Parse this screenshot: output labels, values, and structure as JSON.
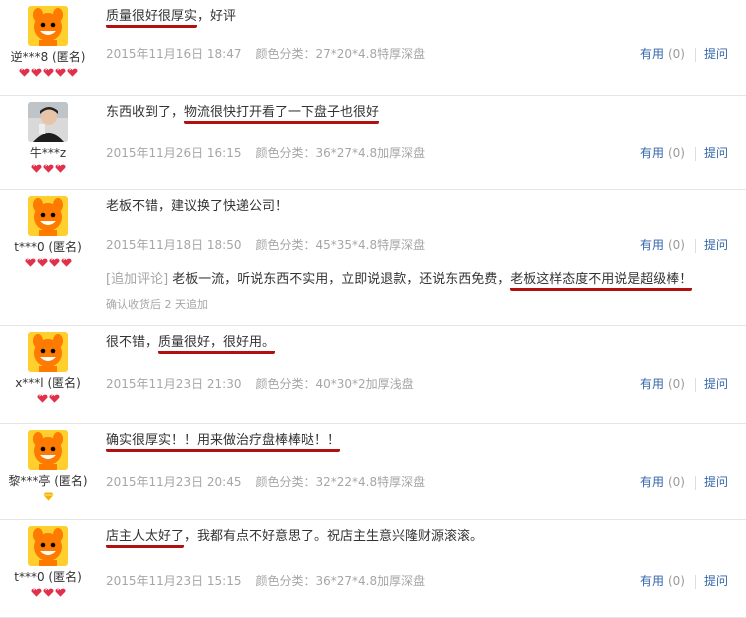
{
  "reviews": [
    {
      "user": "逆***8 (匿名)",
      "avatar": "taobao-mascot",
      "badge": "red-heart",
      "badge_count": 5,
      "text_parts": [
        {
          "t": "质量很好很厚实",
          "u": true
        },
        {
          "t": "，好评",
          "u": false
        }
      ],
      "date": "2015年11月16日 18:47",
      "sku": "颜色分类：27*20*4.8特厚深盘",
      "useful_label": "有用",
      "useful_count": "(0)",
      "ask_label": "提问"
    },
    {
      "user": "牛***z",
      "avatar": "user-photo",
      "badge": "red-heart",
      "badge_count": 3,
      "text_parts": [
        {
          "t": "东西收到了，",
          "u": false
        },
        {
          "t": "物流很快打开看了一下盘子也很好",
          "u": true
        }
      ],
      "date": "2015年11月26日 16:15",
      "sku": "颜色分类：36*27*4.8加厚深盘",
      "useful_label": "有用",
      "useful_count": "(0)",
      "ask_label": "提问"
    },
    {
      "user": "t***0 (匿名)",
      "avatar": "taobao-mascot",
      "badge": "red-heart",
      "badge_count": 4,
      "text_parts": [
        {
          "t": "老板不错，建议换了快递公司！",
          "u": false
        }
      ],
      "date": "2015年11月18日 18:50",
      "sku": "颜色分类：45*35*4.8特厚深盘",
      "useful_label": "有用",
      "useful_count": "(0)",
      "ask_label": "提问",
      "append": {
        "tag": "[追加评论]",
        "parts": [
          {
            "t": " 老板一流，听说东西不实用，立即说退款，还说东西免费，",
            "u": false
          },
          {
            "t": "老板这样态度不用说是超级棒！",
            "u": true
          }
        ],
        "meta": "确认收货后 2 天追加"
      }
    },
    {
      "user": "x***l (匿名)",
      "avatar": "taobao-mascot",
      "badge": "red-heart",
      "badge_count": 2,
      "text_parts": [
        {
          "t": "很不错，",
          "u": false
        },
        {
          "t": "质量很好，很好用。",
          "u": true
        }
      ],
      "date": "2015年11月23日 21:30",
      "sku": "颜色分类：40*30*2加厚浅盘",
      "useful_label": "有用",
      "useful_count": "(0)",
      "ask_label": "提问"
    },
    {
      "user": "黎***亭 (匿名)",
      "avatar": "taobao-mascot",
      "badge": "yellow-diamond",
      "badge_count": 1,
      "text_parts": [
        {
          "t": "确实很厚实！！用来做治疗盘棒棒哒！！",
          "u": true
        }
      ],
      "date": "2015年11月23日 20:45",
      "sku": "颜色分类：32*22*4.8特厚深盘",
      "useful_label": "有用",
      "useful_count": "(0)",
      "ask_label": "提问"
    },
    {
      "user": "t***0 (匿名)",
      "avatar": "taobao-mascot",
      "badge": "red-heart",
      "badge_count": 3,
      "text_parts": [
        {
          "t": "店主人太好了",
          "u": true
        },
        {
          "t": "，我都有点不好意思了。祝店主生意兴隆财源滚滚。",
          "u": false
        }
      ],
      "date": "2015年11月23日 15:15",
      "sku": "颜色分类：36*27*4.8加厚深盘",
      "useful_label": "有用",
      "useful_count": "(0)",
      "ask_label": "提问"
    }
  ],
  "colors": {
    "underline": "#b01010",
    "link": "#3366aa",
    "meta": "#a6a6a6",
    "heart": "#e0304a",
    "diamond": "#f2b400",
    "mascot": "#ff7a00"
  }
}
